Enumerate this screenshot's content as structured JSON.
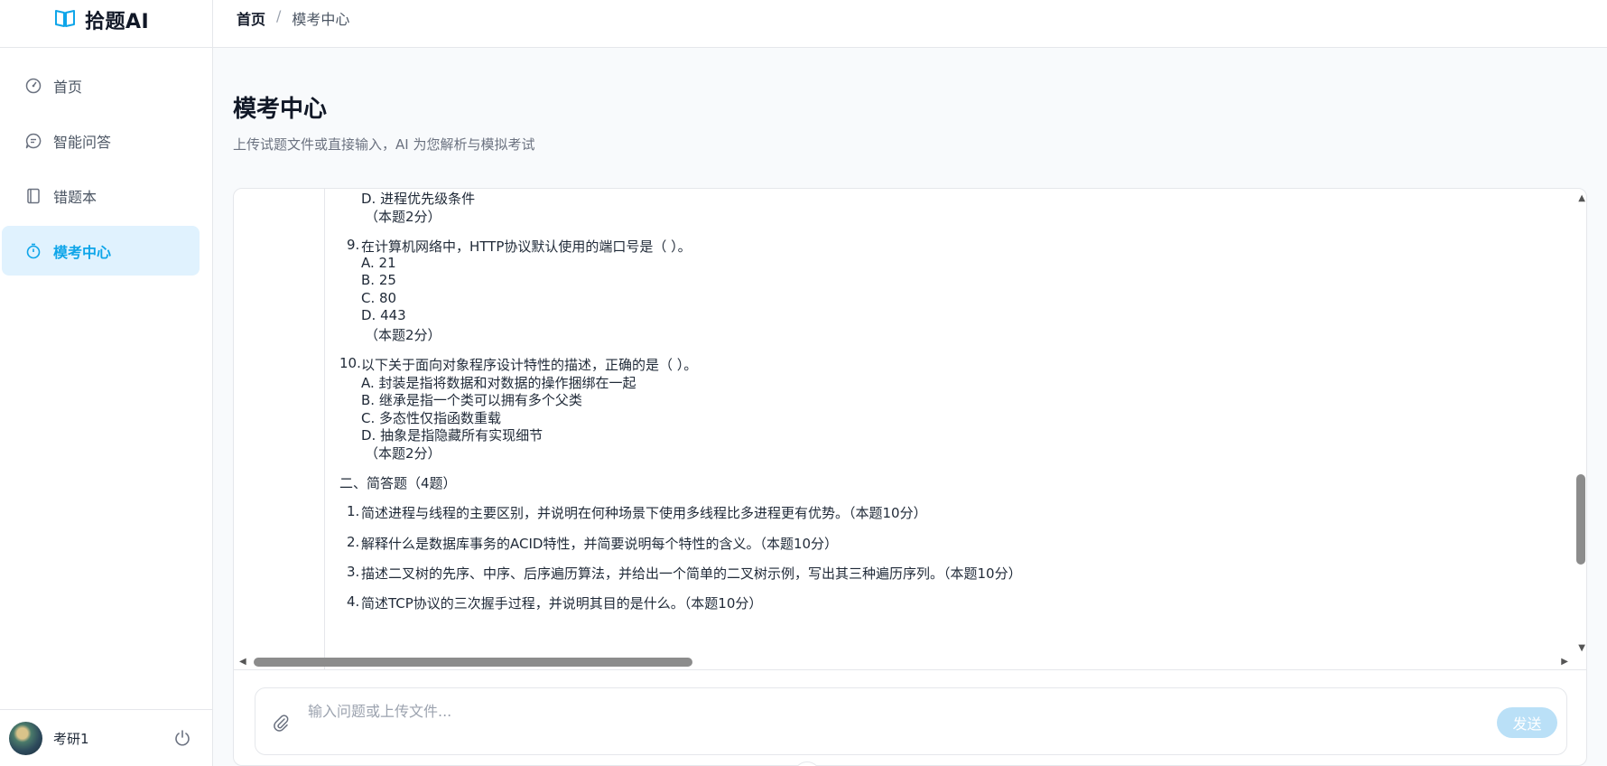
{
  "app": {
    "title": "拾题AI"
  },
  "breadcrumb": {
    "home": "首页",
    "separator": "/",
    "current": "模考中心"
  },
  "sidebar": {
    "items": [
      {
        "label": "首页",
        "icon": "dashboard-icon",
        "active": false
      },
      {
        "label": "智能问答",
        "icon": "chat-icon",
        "active": false
      },
      {
        "label": "错题本",
        "icon": "notebook-icon",
        "active": false
      },
      {
        "label": "模考中心",
        "icon": "timer-icon",
        "active": true
      }
    ],
    "user": {
      "name": "考研1",
      "power_icon": "power-icon"
    }
  },
  "page": {
    "title": "模考中心",
    "description": "上传试题文件或直接输入，AI 为您解析与模拟考试"
  },
  "content": {
    "q8_tail": {
      "option_d": "D. 进程优先级条件",
      "score": "（本题2分）"
    },
    "q9": {
      "number": "9.",
      "text": "在计算机网络中，HTTP协议默认使用的端口号是（ ）。",
      "options": [
        "A. 21",
        "B. 25",
        "C. 80",
        "D. 443"
      ],
      "score": "（本题2分）"
    },
    "q10": {
      "number": "10.",
      "text": "以下关于面向对象程序设计特性的描述，正确的是（ ）。",
      "options": [
        "A. 封装是指将数据和对数据的操作捆绑在一起",
        "B. 继承是指一个类可以拥有多个父类",
        "C. 多态性仅指函数重载",
        "D. 抽象是指隐藏所有实现细节"
      ],
      "score": "（本题2分）"
    },
    "section2": "二、简答题（4题）",
    "short_answers": [
      {
        "number": "1.",
        "text": "简述进程与线程的主要区别，并说明在何种场景下使用多线程比多进程更有优势。（本题10分）"
      },
      {
        "number": "2.",
        "text": "解释什么是数据库事务的ACID特性，并简要说明每个特性的含义。（本题10分）"
      },
      {
        "number": "3.",
        "text": "描述二叉树的先序、中序、后序遍历算法，并给出一个简单的二叉树示例，写出其三种遍历序列。（本题10分）"
      },
      {
        "number": "4.",
        "text": "简述TCP协议的三次握手过程，并说明其目的是什么。（本题10分）"
      }
    ]
  },
  "chat_input": {
    "placeholder": "输入问题或上传文件...",
    "value": "",
    "send_label": "发送"
  },
  "colors": {
    "accent": "#0ea5e9",
    "active_bg": "#e0f2fe",
    "send_disabled": "#bae0f7"
  }
}
